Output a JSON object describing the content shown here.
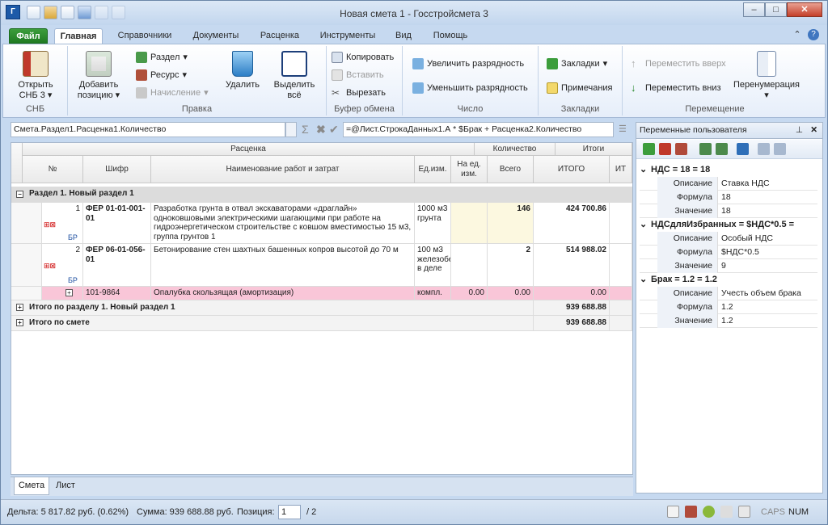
{
  "window": {
    "title": "Новая смета 1 - Госстройсмета 3"
  },
  "tabs": {
    "file": "Файл",
    "items": [
      "Главная",
      "Справочники",
      "Документы",
      "Расценка",
      "Инструменты",
      "Вид",
      "Помощь"
    ]
  },
  "ribbon": {
    "open": "Открыть",
    "open2": "СНБ 3",
    "group_snb": "СНБ",
    "add": "Добавить",
    "add2": "позицию",
    "section": "Раздел",
    "resource": "Ресурс",
    "accrual": "Начисление",
    "delete": "Удалить",
    "selectall": "Выделить",
    "selectall2": "всё",
    "group_edit": "Правка",
    "copy": "Копировать",
    "paste": "Вставить",
    "cut": "Вырезать",
    "group_clipboard": "Буфер обмена",
    "inc_digits": "Увеличить разрядность",
    "dec_digits": "Уменьшить разрядность",
    "group_number": "Число",
    "bookmarks": "Закладки",
    "notes": "Примечания",
    "group_bookmarks": "Закладки",
    "move_up": "Переместить вверх",
    "move_down": "Переместить вниз",
    "renumber": "Перенумерация",
    "group_move": "Перемещение"
  },
  "formula_bar": {
    "path": "Смета.Раздел1.Расценка1.Количество",
    "formula": "=@Лист.СтрокаДанных1.А * $Брак + Расценка2.Количество"
  },
  "grid": {
    "headers": {
      "rate": "Расценка",
      "qty": "Количество",
      "totals": "Итоги",
      "num": "№",
      "code": "Шифр",
      "name": "Наименование работ и затрат",
      "unit": "Ед.изм.",
      "per_unit": "На ед. изм.",
      "all": "Всего",
      "total": "ИТОГО",
      "it": "ИТ"
    },
    "section": "Раздел 1. Новый раздел 1",
    "rows": [
      {
        "num": "1",
        "code": "ФЕР 01-01-001-01",
        "tag": "БР",
        "name": "Разработка грунта в отвал экскаваторами «драглайн» одноковшовыми электрическими шагающими при работе на гидроэнергетическом строительстве с ковшом вместимостью 15 м3, группа грунтов 1",
        "unit": "1000 м3 грунта",
        "per_unit": "",
        "all": "146",
        "total": "424 700.86"
      },
      {
        "num": "2",
        "code": "ФЕР 06-01-056-01",
        "tag": "БР",
        "name": "Бетонирование стен шахтных башенных копров высотой до 70 м",
        "unit": "100 м3 железобетона в деле",
        "per_unit": "",
        "all": "2",
        "total": "514 988.02"
      },
      {
        "code": "101-9864",
        "name": "Опалубка скользящая (амортизация)",
        "unit": "компл.",
        "per_unit": "0.00",
        "all": "0.00",
        "total": "0.00"
      }
    ],
    "section_total_label": "Итого по разделу 1. Новый раздел 1",
    "section_total": "939 688.88",
    "estimate_total_label": "Итого по смете",
    "estimate_total": "939 688.88"
  },
  "sheet_tabs": [
    "Смета",
    "Лист"
  ],
  "panel": {
    "title": "Переменные пользователя",
    "vars": [
      {
        "head": "НДС  =  18 = 18",
        "desc_label": "Описание",
        "desc": "Ставка НДС",
        "formula_label": "Формула",
        "formula": "18",
        "value_label": "Значение",
        "value": "18"
      },
      {
        "head": "НДСдляИзбранных  =  $НДС*0.5 =",
        "desc_label": "Описание",
        "desc": "Особый НДС",
        "formula_label": "Формула",
        "formula": "$НДС*0.5",
        "value_label": "Значение",
        "value": "9"
      },
      {
        "head": "Брак  =  1.2 = 1.2",
        "desc_label": "Описание",
        "desc": "Учесть объем брака",
        "formula_label": "Формула",
        "formula": "1.2",
        "value_label": "Значение",
        "value": "1.2"
      }
    ]
  },
  "status": {
    "delta": "Дельта: 5 817.82 руб. (0.62%)",
    "sum": "Сумма: 939 688.88 руб.",
    "position_label": "Позиция:",
    "position": "1",
    "of": "/ 2",
    "caps": "CAPS",
    "num": "NUM"
  },
  "colors": {
    "file_tab": "#2a8a2d",
    "pink_row": "#f9c6d8",
    "section": "#dcdcdc",
    "ribbon_bg": "#e6eefa"
  }
}
